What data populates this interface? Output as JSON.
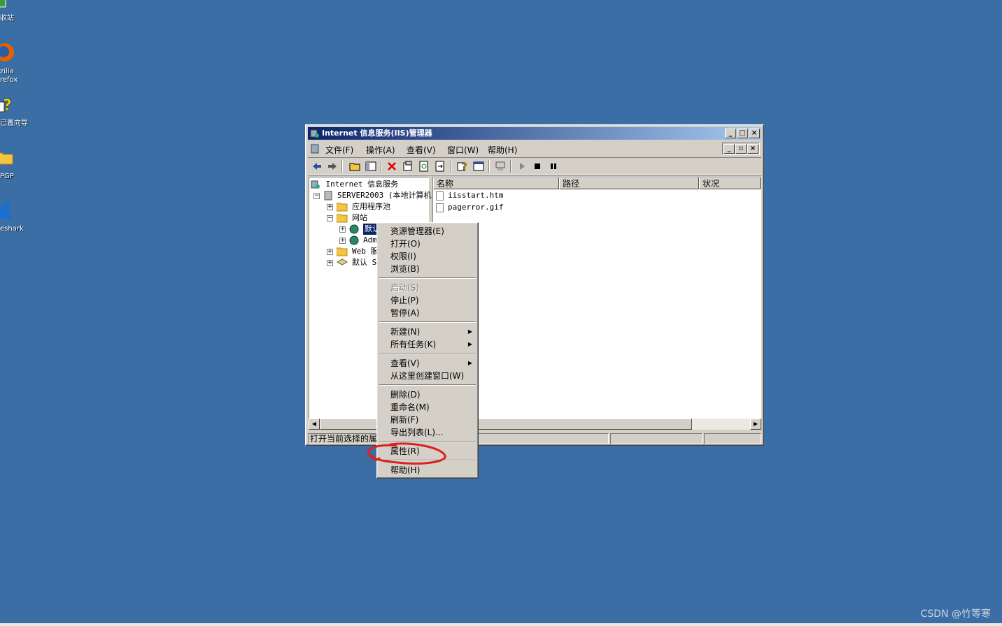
{
  "desktop": {
    "icons": [
      {
        "label": "收站"
      },
      {
        "label": "zilla\nrefox"
      },
      {
        "label": "己置向导"
      },
      {
        "label": "PGP"
      },
      {
        "label": "eshark"
      }
    ]
  },
  "window": {
    "title": "Internet 信息服务(IIS)管理器",
    "menu": [
      {
        "label": "文件(F)"
      },
      {
        "label": "操作(A)"
      },
      {
        "label": "查看(V)"
      },
      {
        "label": "窗口(W)"
      },
      {
        "label": "帮助(H)"
      }
    ],
    "tree": {
      "root": "Internet 信息服务",
      "server": "SERVER2003 (本地计算机",
      "app_pools": "应用程序池",
      "websites": "网站",
      "default_site": "默认",
      "admin_site": "Adm",
      "web_ext": "Web 服",
      "default_smtp": "默认 S"
    },
    "list": {
      "columns": [
        "名称",
        "路径",
        "状况"
      ],
      "files": [
        "iisstart.htm",
        "pagerror.gif"
      ]
    },
    "status": "打开当前选择的属性"
  },
  "context_menu": {
    "items": [
      {
        "label": "资源管理器(E)",
        "disabled": false
      },
      {
        "label": "打开(O)",
        "disabled": false
      },
      {
        "label": "权限(I)",
        "disabled": false
      },
      {
        "label": "浏览(B)",
        "disabled": false
      },
      {
        "label": "启动(S)",
        "disabled": true
      },
      {
        "label": "停止(P)",
        "disabled": false
      },
      {
        "label": "暂停(A)",
        "disabled": false
      },
      {
        "label": "新建(N)",
        "disabled": false,
        "submenu": true
      },
      {
        "label": "所有任务(K)",
        "disabled": false,
        "submenu": true
      },
      {
        "label": "查看(V)",
        "disabled": false,
        "submenu": true
      },
      {
        "label": "从这里创建窗口(W)",
        "disabled": false
      },
      {
        "label": "删除(D)",
        "disabled": false
      },
      {
        "label": "重命名(M)",
        "disabled": false
      },
      {
        "label": "刷新(F)",
        "disabled": false
      },
      {
        "label": "导出列表(L)...",
        "disabled": false
      },
      {
        "label": "属性(R)",
        "disabled": false,
        "highlighted": true
      },
      {
        "label": "帮助(H)",
        "disabled": false
      }
    ]
  },
  "watermark": "CSDN @竹等寒",
  "colors": {
    "desktop": "#3a6ea5",
    "annotation": "#e02020"
  }
}
